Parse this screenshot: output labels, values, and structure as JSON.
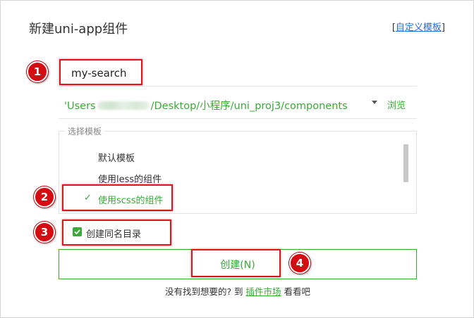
{
  "dialog": {
    "title": "新建uni-app组件",
    "custom_template_link": {
      "bracket_open": "[",
      "label": "自定义模板",
      "bracket_close": "]"
    }
  },
  "name_input": {
    "value": "my-search"
  },
  "path": {
    "prefix": "'Users",
    "suffix": "/Desktop/小程序/uni_proj3/components",
    "browse_label": "浏览",
    "dropdown_icon": "caret-down-icon"
  },
  "templates": {
    "legend": "选择模板",
    "items": [
      {
        "label": "默认模板",
        "selected": false
      },
      {
        "label": "使用less的组件",
        "selected": false
      },
      {
        "label": "使用scss的组件",
        "selected": true
      }
    ],
    "check_icon": "✓"
  },
  "checkbox": {
    "label": "创建同名目录",
    "checked": true
  },
  "create_button": {
    "label": "创建(N)"
  },
  "footer": {
    "prefix": "没有找到想要的? 到",
    "link": "插件市场",
    "suffix": "看看吧"
  },
  "annotations": {
    "badges": [
      "1",
      "2",
      "3",
      "4"
    ]
  },
  "colors": {
    "accent_green": "#3aa83a",
    "link_blue": "#2a6fd6",
    "annotation_red": "#d40c12"
  }
}
